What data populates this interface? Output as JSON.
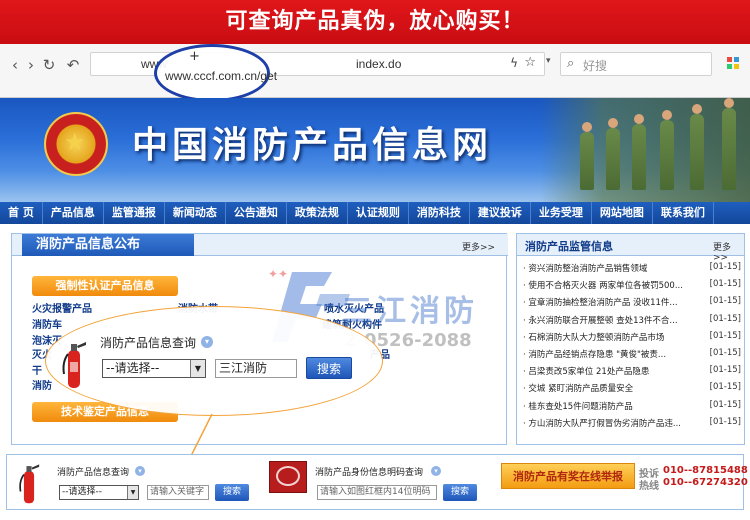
{
  "promo": {
    "text": "可查询产品真伪，放心购买！"
  },
  "browser": {
    "nav": {
      "back": "‹",
      "forward": "›",
      "reload": "↻",
      "undo": "↶"
    },
    "address_prefix": "www",
    "address_suffix": "index.do",
    "zoom_url": "www.cccf.com.cn/get",
    "zoom_plus": "+",
    "search_placeholder": "好搜"
  },
  "site": {
    "title": "中国消防产品信息网"
  },
  "main_nav": [
    "首 页",
    "产品信息",
    "监管通报",
    "新闻动态",
    "公告通知",
    "政策法规",
    "认证规则",
    "消防科技",
    "建议投诉",
    "业务受理",
    "网站地图",
    "联系我们"
  ],
  "left_panel": {
    "tab": "消防产品信息公布",
    "more": "更多>>",
    "sub_head_1": "强制性认证产品信息",
    "sub_head_2": "技术鉴定产品信息",
    "categories": [
      "火灾报警产品",
      "消防车",
      "泡沫灭",
      "灭火",
      "干",
      "消防",
      "消防水带",
      "喷水灭火产品",
      "建筑耐火构件",
      "产品"
    ]
  },
  "right_panel": {
    "title": "消防产品监管信息",
    "more": "更多>>",
    "news": [
      {
        "title": "资兴消防整治消防产品销售领域",
        "date": "[01-15]"
      },
      {
        "title": "使用不合格灭火器 两家单位各被罚500...",
        "date": "[01-15]"
      },
      {
        "title": "宜章消防抽检整治消防产品 没收11件...",
        "date": "[01-15]"
      },
      {
        "title": "永兴消防联合开展整顿 查处13件不合...",
        "date": "[01-15]"
      },
      {
        "title": "石棉消防大队大力整顿消防产品市场",
        "date": "[01-15]"
      },
      {
        "title": "消防产品经销点存隐患 \"黄俊\"被责...",
        "date": "[01-15]"
      },
      {
        "title": "吕梁责改5家单位 21处产品隐患",
        "date": "[01-15]"
      },
      {
        "title": "交城 紧盯消防产品质量安全",
        "date": "[01-15]"
      },
      {
        "title": "桂东查处15件问题消防产品",
        "date": "[01-15]"
      },
      {
        "title": "方山消防大队严打假冒伪劣消防产品违...",
        "date": "[01-15]"
      }
    ]
  },
  "watermark": {
    "name": "三江消防",
    "phone": "2-0526-2088"
  },
  "query_zoom": {
    "title": "消防产品信息查询",
    "select_value": "--请选择--",
    "input_value": "三江消防",
    "button": "搜索"
  },
  "bottom": {
    "q1_title": "消防产品信息查询",
    "q1_select": "--请选择--",
    "q1_placeholder": "请输入关键字",
    "q1_button": "搜索",
    "q2_title": "消防产品身份信息明码查询",
    "q2_placeholder": "请输入如图红框内14位明码",
    "q2_button": "搜索",
    "report": "消防产品有奖在线举报",
    "complaint_label": "投诉",
    "hotline_label": "热线",
    "phone_1": "010--87815488",
    "phone_2": "010--67274320"
  },
  "colors": {
    "promo_red": "#d8131a",
    "nav_blue": "#13479b",
    "accent_orange": "#f39c12"
  }
}
